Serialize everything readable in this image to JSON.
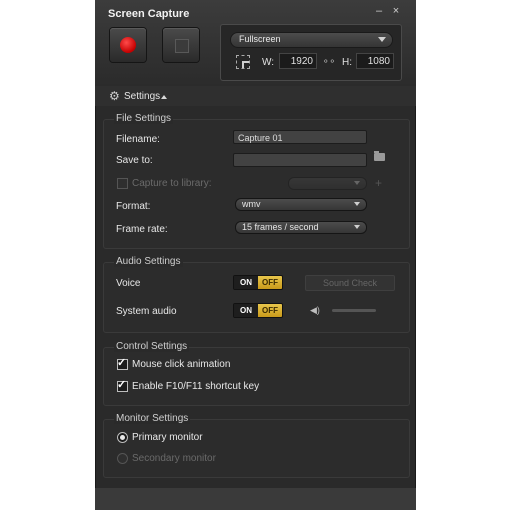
{
  "window": {
    "title": "Screen Capture",
    "minimize_glyph": "–",
    "close_glyph": "×"
  },
  "capture": {
    "mode": "Fullscreen",
    "width_label": "W:",
    "width": "1920",
    "height_label": "H:",
    "height": "1080",
    "link_glyph": "⚬⚬"
  },
  "settings_toggle": {
    "label": "Settings"
  },
  "file_settings": {
    "title": "File Settings",
    "filename_label": "Filename:",
    "filename_value": "Capture 01",
    "save_to_label": "Save to:",
    "save_to_value": "",
    "capture_to_library_label": "Capture to library:",
    "format_label": "Format:",
    "format_value": "wmv",
    "frame_rate_label": "Frame rate:",
    "frame_rate_value": "15 frames / second"
  },
  "audio_settings": {
    "title": "Audio Settings",
    "voice_label": "Voice",
    "system_audio_label": "System audio",
    "on_label": "ON",
    "off_label": "OFF",
    "sound_check_label": "Sound Check"
  },
  "control_settings": {
    "title": "Control Settings",
    "mouse_click_label": "Mouse click animation",
    "shortcut_label": "Enable F10/F11 shortcut key"
  },
  "monitor_settings": {
    "title": "Monitor Settings",
    "primary_label": "Primary monitor",
    "secondary_label": "Secondary monitor"
  },
  "colors": {
    "record": "#d40000",
    "toggle_off": "#e2b833",
    "background": "#2a2a2a"
  }
}
